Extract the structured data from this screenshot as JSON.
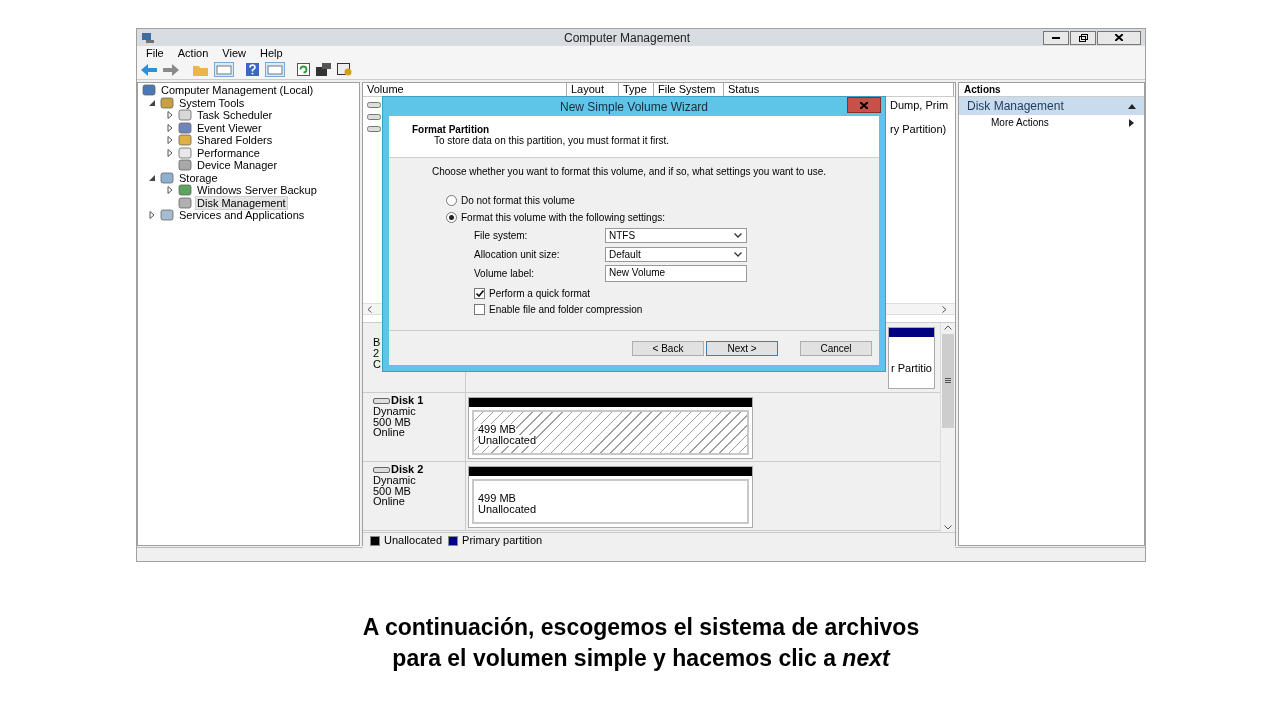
{
  "window": {
    "title": "Computer Management"
  },
  "menu": [
    "File",
    "Action",
    "View",
    "Help"
  ],
  "tree": [
    {
      "label": "Computer Management (Local)",
      "selected": false,
      "children": [
        {
          "label": "System Tools",
          "expanded": true,
          "selected": false,
          "children": [
            {
              "label": "Task Scheduler",
              "expanded": false,
              "selected": false
            },
            {
              "label": "Event Viewer",
              "expanded": false,
              "selected": false
            },
            {
              "label": "Shared Folders",
              "expanded": false,
              "selected": false
            },
            {
              "label": "Performance",
              "expanded": false,
              "selected": false
            },
            {
              "label": "Device Manager",
              "selected": false
            }
          ]
        },
        {
          "label": "Storage",
          "expanded": true,
          "selected": false,
          "children": [
            {
              "label": "Windows Server Backup",
              "expanded": false,
              "selected": false
            },
            {
              "label": "Disk Management",
              "selected": true
            }
          ]
        },
        {
          "label": "Services and Applications",
          "expanded": false,
          "selected": false
        }
      ]
    }
  ],
  "volume_list": {
    "columns": [
      "Volume",
      "Layout",
      "Type",
      "File System",
      "Status"
    ],
    "rows": [
      {
        "kind": "volume",
        "status": "Dump, Prim"
      },
      {
        "kind": "volume"
      },
      {
        "kind": "volume",
        "status": "ry Partition)"
      }
    ]
  },
  "disks": [
    {
      "kind": "partial",
      "label_fragments": [
        "B",
        "2",
        "C"
      ],
      "partition": {
        "kind": "primary",
        "status": "r Partitio",
        "selected": false
      }
    },
    {
      "kind": "disk",
      "name": "Disk 1",
      "type": "Dynamic",
      "size": "500 MB",
      "status": "Online",
      "partition": {
        "kind": "unallocated",
        "size": "499 MB",
        "status": "Unallocated",
        "selected": true
      }
    },
    {
      "kind": "disk",
      "name": "Disk 2",
      "type": "Dynamic",
      "size": "500 MB",
      "status": "Online",
      "partition": {
        "kind": "unallocated",
        "size": "499 MB",
        "status": "Unallocated",
        "selected": false
      }
    }
  ],
  "legend": [
    {
      "label": "Unallocated",
      "color": "#000000"
    },
    {
      "label": "Primary partition",
      "color": "#000080"
    }
  ],
  "actions": {
    "title": "Actions",
    "section": "Disk Management",
    "items": [
      "More Actions"
    ]
  },
  "dialog": {
    "title": "New Simple Volume Wizard",
    "heading": "Format Partition",
    "subheading": "To store data on this partition, you must format it first.",
    "prompt": "Choose whether you want to format this volume, and if so, what settings you want to use.",
    "options": [
      {
        "label": "Do not format this volume",
        "selected": false
      },
      {
        "label": "Format this volume with the following settings:",
        "selected": true
      }
    ],
    "fields": [
      {
        "kind": "dropdown",
        "label": "File system:",
        "value": "NTFS"
      },
      {
        "kind": "dropdown",
        "label": "Allocation unit size:",
        "value": "Default"
      },
      {
        "kind": "text",
        "label": "Volume label:",
        "value": "New Volume"
      }
    ],
    "checkboxes": [
      {
        "label": "Perform a quick format",
        "checked": true
      },
      {
        "label": "Enable file and folder compression",
        "checked": false
      }
    ],
    "buttons": [
      {
        "label": "< Back",
        "default": false
      },
      {
        "label": "Next >",
        "default": true
      },
      {
        "label": "Cancel",
        "default": false
      }
    ]
  },
  "caption": [
    "A continuación, escogemos el sistema de archivos",
    "para el volumen simple y hacemos clic a *next*"
  ]
}
